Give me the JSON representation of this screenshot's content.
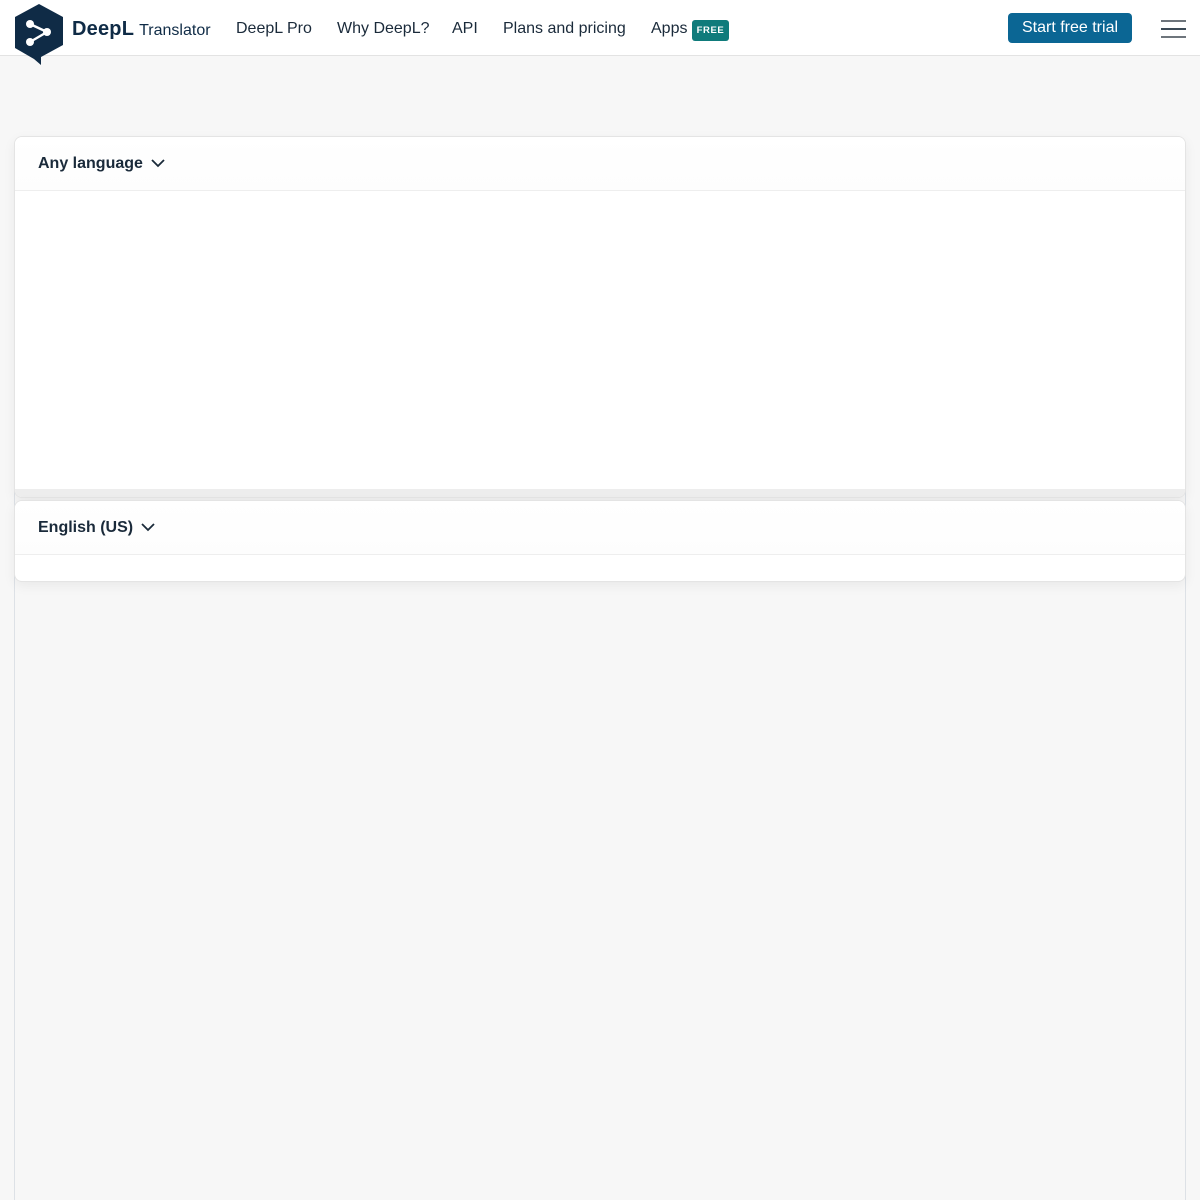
{
  "header": {
    "brand_name": "DeepL",
    "brand_sub": "Translator",
    "nav": [
      {
        "label": "DeepL Pro"
      },
      {
        "label": "Why DeepL?"
      },
      {
        "label": "API"
      },
      {
        "label": "Plans and pricing"
      },
      {
        "label": "Apps"
      }
    ],
    "apps_badge": "FREE",
    "cta_label": "Start free trial",
    "logo_icon": "deepl-logo-icon",
    "menu_icon": "hamburger-menu-icon"
  },
  "colors": {
    "brand_navy": "#0f2b46",
    "cta_blue": "#0b6694",
    "badge_teal": "#0f7b7b",
    "page_bg": "#f7f7f7"
  },
  "translator": {
    "source": {
      "language": "Any language",
      "text": ""
    },
    "target": {
      "language": "English (US)",
      "text": ""
    }
  }
}
